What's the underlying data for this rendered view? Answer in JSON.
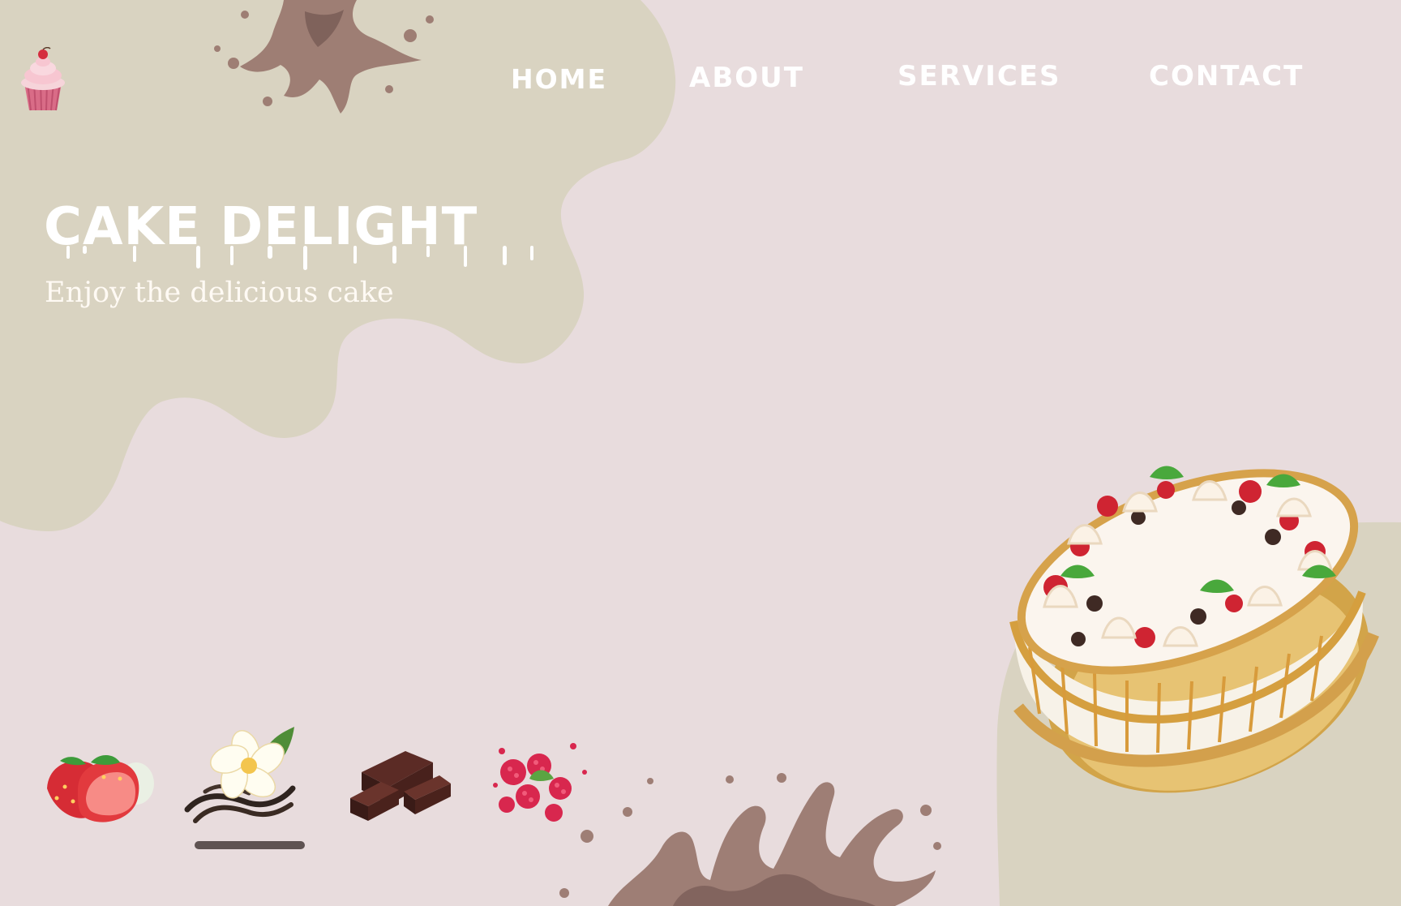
{
  "nav": {
    "items": [
      {
        "label": "HOME"
      },
      {
        "label": "ABOUT"
      },
      {
        "label": "SERVICES"
      },
      {
        "label": "CONTACT"
      }
    ]
  },
  "hero": {
    "title": "CAKE DELIGHT",
    "subtitle": "Enjoy the delicious cake"
  },
  "flavors": {
    "items": [
      {
        "icon": "strawberry-icon"
      },
      {
        "icon": "vanilla-icon"
      },
      {
        "icon": "chocolate-icon"
      },
      {
        "icon": "raspberry-icon"
      }
    ],
    "selected_index": 1
  },
  "colors": {
    "background": "#e8dcdd",
    "blob": "#d9d3c1",
    "nav_text": "#ffffff",
    "active_indicator": "#5f5352",
    "splash": "#9b7a70"
  },
  "icons": {
    "logo": "cupcake-icon",
    "hero_image": "fruit-cake-icon",
    "decor_top": "chocolate-splash-icon",
    "decor_bottom": "chocolate-splash-icon"
  }
}
